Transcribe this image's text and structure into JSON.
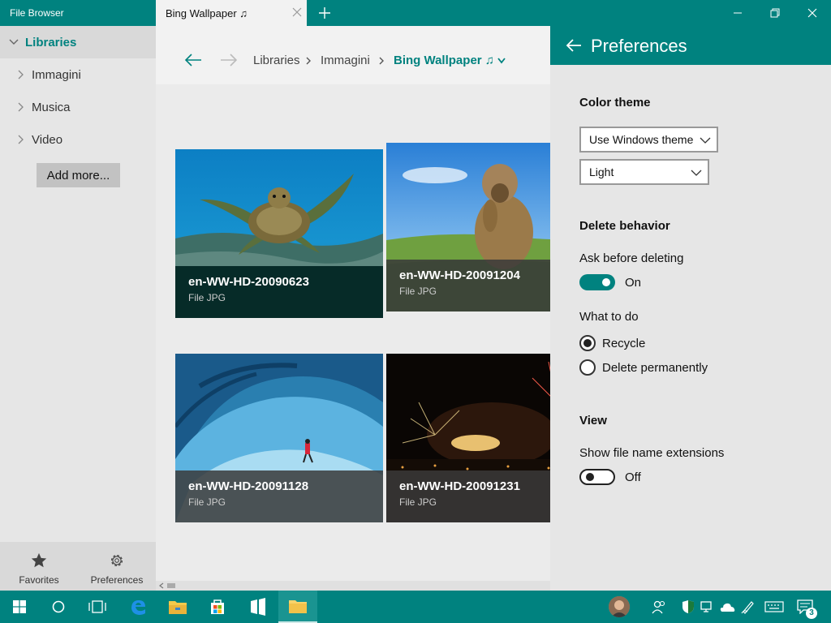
{
  "app": {
    "title": "File Browser"
  },
  "tab": {
    "label": "Bing Wallpaper ♫"
  },
  "sidebar": {
    "libraries_label": "Libraries",
    "items": [
      {
        "label": "Immagini"
      },
      {
        "label": "Musica"
      },
      {
        "label": "Video"
      }
    ],
    "add_more_label": "Add more...",
    "bottom": {
      "favorites_label": "Favorites",
      "preferences_label": "Preferences"
    }
  },
  "breadcrumb": {
    "items": [
      "Libraries",
      "Immagini"
    ],
    "current": "Bing Wallpaper ♫"
  },
  "files": [
    {
      "name": "en-WW-HD-20090623",
      "type": "File JPG",
      "selected": true
    },
    {
      "name": "en-WW-HD-20091204",
      "type": "File JPG",
      "selected": false
    },
    {
      "name": "en-WW-HD-20091128",
      "type": "File JPG",
      "selected": false
    },
    {
      "name": "en-WW-HD-20091231",
      "type": "File JPG",
      "selected": false
    }
  ],
  "preferences": {
    "title": "Preferences",
    "color_theme": {
      "title": "Color theme",
      "theme_select": "Use Windows theme",
      "mode_select": "Light"
    },
    "delete_behavior": {
      "title": "Delete behavior",
      "ask_label": "Ask before deleting",
      "ask_state": "On",
      "what_to_do_label": "What to do",
      "options": [
        {
          "label": "Recycle",
          "checked": true
        },
        {
          "label": "Delete permanently",
          "checked": false
        }
      ]
    },
    "view": {
      "title": "View",
      "extensions_label": "Show file name extensions",
      "extensions_state": "Off"
    }
  },
  "taskbar": {
    "notification_count": "3"
  },
  "colors": {
    "accent": "#00827f",
    "sidebar_bg": "#e6e6e6",
    "selected_caption": "#062b28"
  }
}
